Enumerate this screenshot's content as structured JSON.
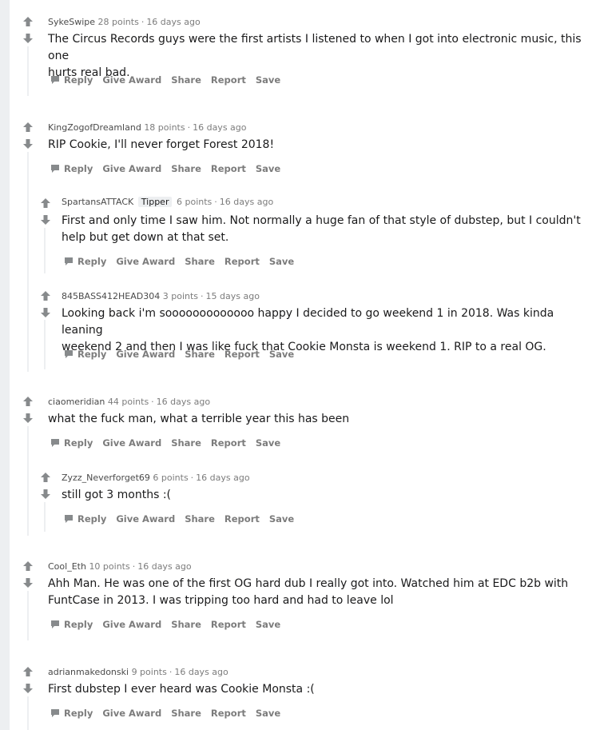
{
  "colors": {
    "upvote_arrow": "#878a8c",
    "meta": "#7c7c7c",
    "body": "#1a1a1b",
    "thread_line": "#edeff1"
  },
  "actions": {
    "reply": "Reply",
    "give_award": "Give Award",
    "share": "Share",
    "report": "Report",
    "save": "Save"
  },
  "comments": [
    {
      "author": "SykeSwipe",
      "points": "28 points",
      "sep": "·",
      "age": "16 days ago",
      "body": [
        "The Circus Records guys were the first artists I listened to when I got into electronic music, this one",
        "hurts real bad."
      ]
    },
    {
      "author": "KingZogofDreamland",
      "points": "18 points",
      "sep": "·",
      "age": "16 days ago",
      "body": [
        "RIP Cookie, I'll never forget Forest 2018!"
      ]
    },
    {
      "author": "SpartansATTACK",
      "flair": "Tipper",
      "points": "6 points",
      "sep": "·",
      "age": "16 days ago",
      "body": [
        "First and only time I saw him. Not normally a huge fan of that style of dubstep, but I couldn't",
        "help but get down at that set."
      ]
    },
    {
      "author": "845BASS412HEAD304",
      "points": "3 points",
      "sep": "·",
      "age": "15 days ago",
      "body": [
        "Looking back i'm sooooooooooooo happy I decided to go weekend 1 in 2018. Was kinda leaning",
        "weekend 2 and then I was like fuck that Cookie Monsta is weekend 1. RIP to a real OG."
      ]
    },
    {
      "author": "ciaomeridian",
      "points": "44 points",
      "sep": "·",
      "age": "16 days ago",
      "body": [
        "what the fuck man, what a terrible year this has been"
      ]
    },
    {
      "author": "Zyzz_Neverforget69",
      "points": "6 points",
      "sep": "·",
      "age": "16 days ago",
      "body": [
        "still got 3 months :("
      ]
    },
    {
      "author": "Cool_Eth",
      "points": "10 points",
      "sep": "·",
      "age": "16 days ago",
      "body": [
        "Ahh Man. He was one of the first OG hard dub I really got into. Watched him at EDC b2b with",
        "FuntCase in 2013. I was tripping too hard and had to leave lol"
      ]
    },
    {
      "author": "adrianmakedonski",
      "points": "9 points",
      "sep": "·",
      "age": "16 days ago",
      "body": [
        "First dubstep I ever heard was Cookie Monsta :("
      ]
    }
  ]
}
